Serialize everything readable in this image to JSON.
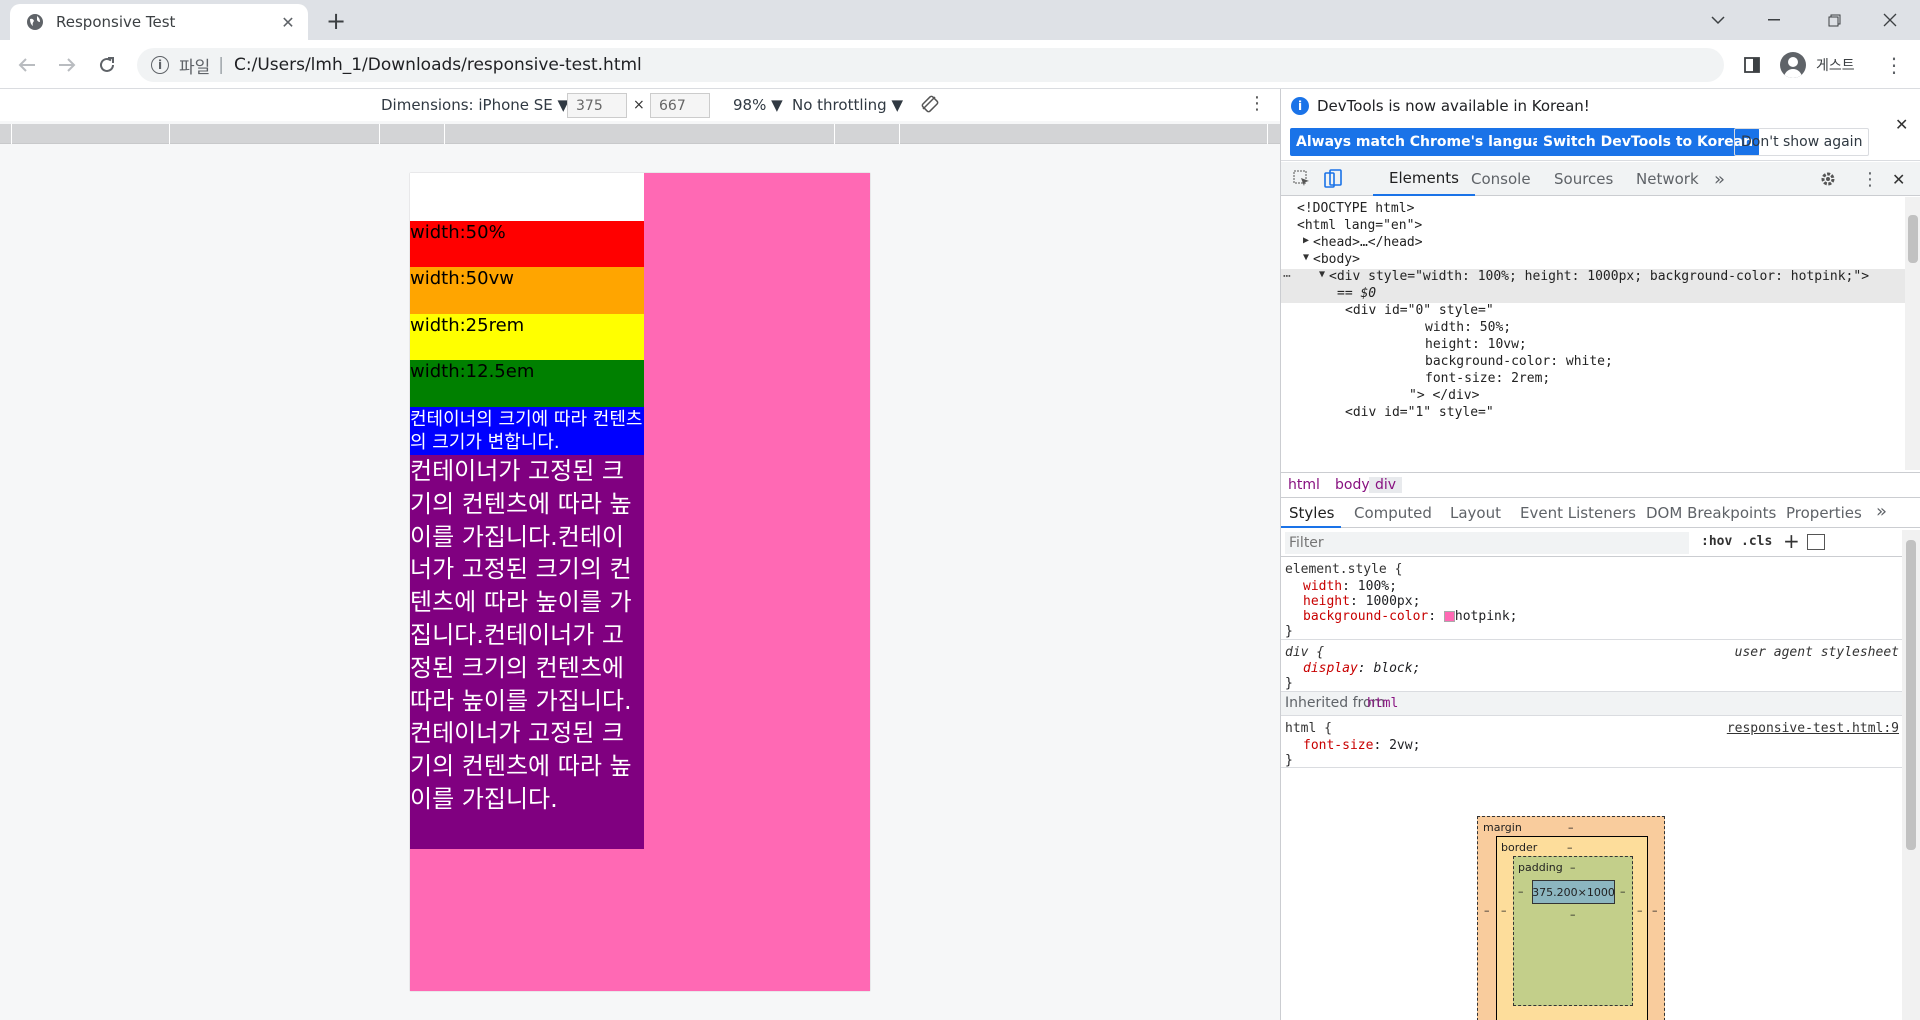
{
  "browser": {
    "tab_title": "Responsive Test",
    "address_scheme": "파일",
    "address_sep": "|",
    "address_path": "C:/Users/lmh_1/Downloads/responsive-test.html",
    "profile_label": "게스트"
  },
  "device_toolbar": {
    "dimensions_label": "Dimensions: iPhone SE ▼",
    "width": "375",
    "times": "×",
    "height": "667",
    "zoom": "98% ▼",
    "throttling": "No throttling ▼"
  },
  "page": {
    "blocks": [
      {
        "label": "",
        "color": "#ffffff"
      },
      {
        "label": "width:50%",
        "color": "#ff0000"
      },
      {
        "label": "width:50vw",
        "color": "#ffa500"
      },
      {
        "label": "width:25rem",
        "color": "#ffff00"
      },
      {
        "label": "width:12.5em",
        "color": "#008000"
      }
    ],
    "blue_text": "컨테이너의 크기에 따라 컨텐츠의 크기가 변합니다.",
    "purple_text": "컨테이너가 고정된 크기의 컨텐츠에 따라 높이를 가집니다.컨테이너가 고정된 크기의 컨텐츠에 따라 높이를 가집니다.컨테이너가 고정된 크기의 컨텐츠에 따라 높이를 가집니다.컨테이너가 고정된 크기의 컨텐츠에 따라 높이를 가집니다.",
    "background": "#ff69b4"
  },
  "devtools": {
    "info_message": "DevTools is now available in Korean!",
    "btn_match": "Always match Chrome's language",
    "btn_switch": "Switch DevTools to Korean",
    "btn_dont": "Don't show again",
    "tabs": [
      "Elements",
      "Console",
      "Sources",
      "Network"
    ],
    "more_tabs": "»",
    "dom": {
      "doctype": "<!DOCTYPE html>",
      "html_open": "<html lang=\"en\">",
      "head": "<head>…</head>",
      "body": "<body>",
      "div_selected": "<div style=\"width: 100%; height: 1000px; background-color: hotpink;\">",
      "eq0": "== $0",
      "div0_open": "<div id=\"0\" style=\"",
      "div0_l1": "width: 50%;",
      "div0_l2": "height: 10vw;",
      "div0_l3": "background-color: white;",
      "div0_l4": "font-size: 2rem;",
      "div0_close": "\"> </div>",
      "div1_open": "<div id=\"1\" style=\""
    },
    "breadcrumbs": [
      "html",
      "body",
      "div"
    ],
    "style_tabs": [
      "Styles",
      "Computed",
      "Layout",
      "Event Listeners",
      "DOM Breakpoints",
      "Properties"
    ],
    "filter_placeholder": "Filter",
    "hov": ":hov",
    "cls": ".cls",
    "rules": {
      "element_selector": "element.style {",
      "el_p1_name": "width",
      "el_p1_val": "100%;",
      "el_p2_name": "height",
      "el_p2_val": "1000px;",
      "el_p3_name": "background-color",
      "el_p3_val": "hotpink;",
      "close": "}",
      "div_selector": "div {",
      "ua_label": "user agent stylesheet",
      "div_p1_name": "display",
      "div_p1_val": "block;",
      "inherited": "Inherited from",
      "inherited_tag": "html",
      "html_selector": "html {",
      "html_src": "responsive-test.html:9",
      "html_p1_name": "font-size",
      "html_p1_val": "2vw;"
    },
    "boxmodel": {
      "margin": "margin",
      "border": "border",
      "padding": "padding",
      "content": "375.200×1000",
      "dash": "–"
    }
  }
}
